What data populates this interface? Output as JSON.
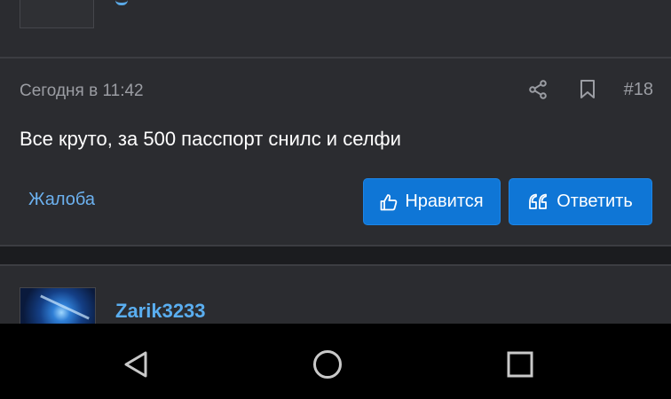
{
  "post": {
    "timestamp": "Сегодня в 11:42",
    "number": "#18",
    "text": "Все круто, за 500 пасспорт снилс и селфи",
    "report_label": "Жалоба",
    "like_label": "Нравится",
    "reply_label": "Ответить"
  },
  "next_post": {
    "username": "Zarik3233"
  },
  "icons": {
    "share": "share-icon",
    "bookmark": "bookmark-icon",
    "like": "thumbs-up-icon",
    "quote": "quote-icon",
    "nav_back": "triangle-back-icon",
    "nav_home": "circle-home-icon",
    "nav_recents": "square-recents-icon"
  },
  "colors": {
    "background": "#2b2c30",
    "accent": "#0f76d6",
    "link": "#6cb1ef",
    "username": "#5aaef0",
    "muted_text": "#9b9da3"
  }
}
